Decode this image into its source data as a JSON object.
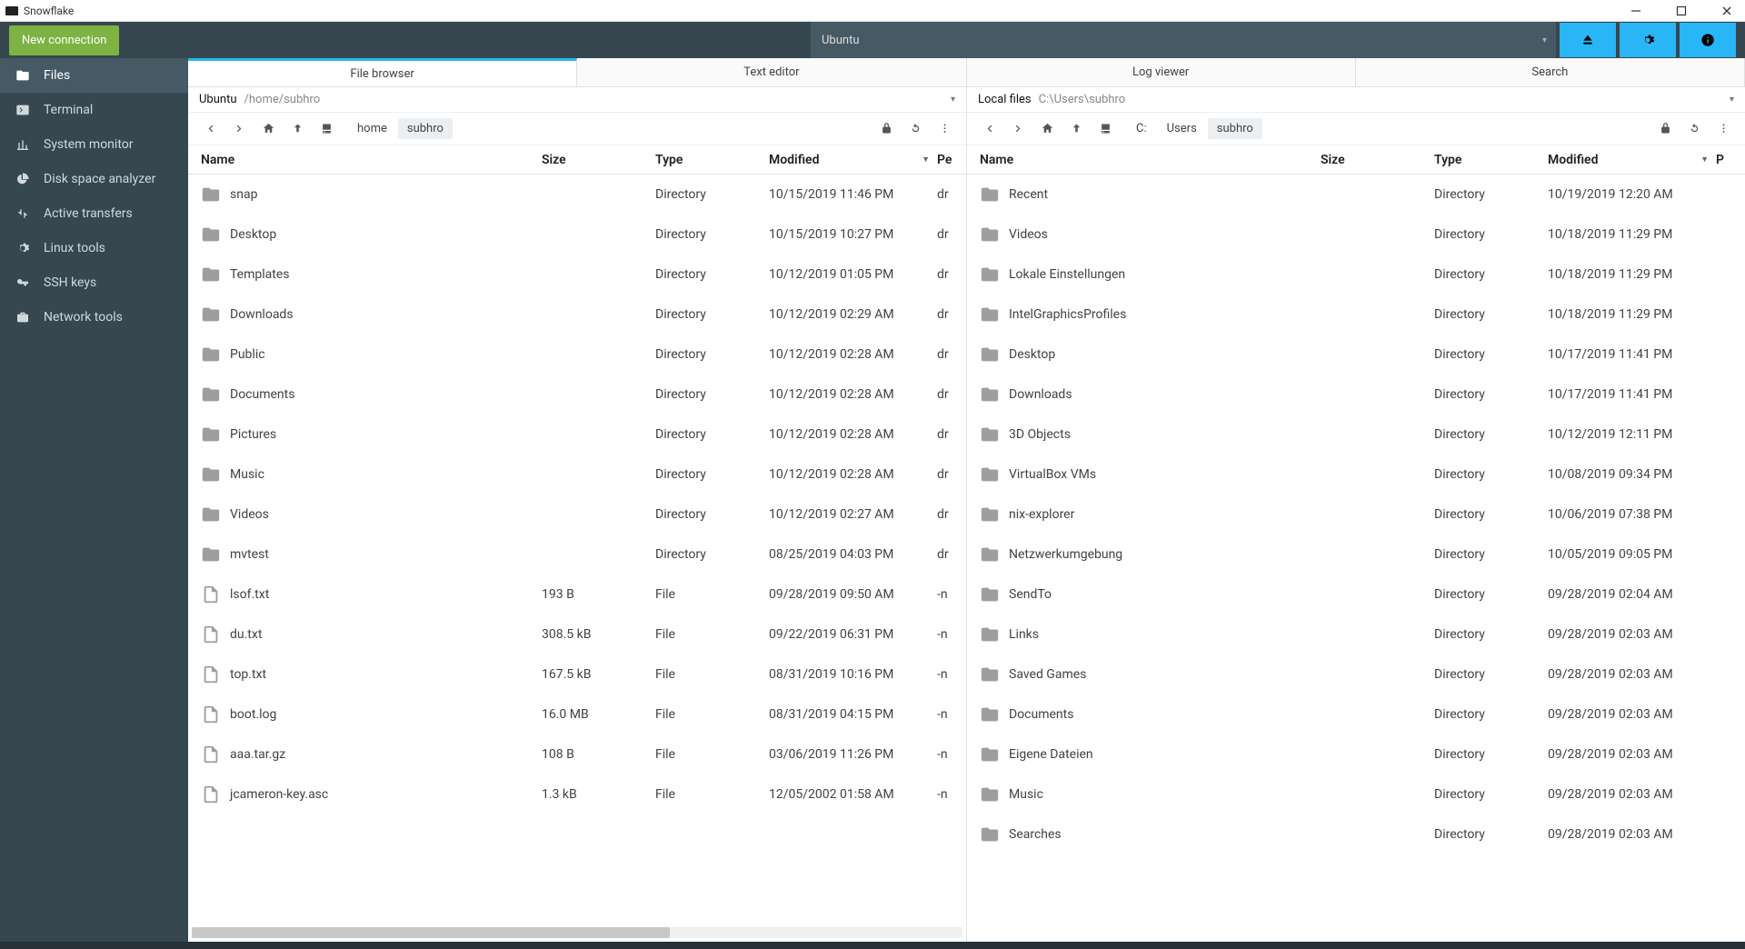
{
  "app_title": "Snowflake",
  "toolbar": {
    "new_connection": "New connection",
    "session_label": "Ubuntu"
  },
  "sidebar": {
    "items": [
      {
        "label": "Files",
        "icon": "folder"
      },
      {
        "label": "Terminal",
        "icon": "terminal"
      },
      {
        "label": "System monitor",
        "icon": "chart"
      },
      {
        "label": "Disk space analyzer",
        "icon": "pie"
      },
      {
        "label": "Active transfers",
        "icon": "transfer"
      },
      {
        "label": "Linux tools",
        "icon": "gear"
      },
      {
        "label": "SSH keys",
        "icon": "key"
      },
      {
        "label": "Network tools",
        "icon": "briefcase"
      }
    ],
    "active_index": 0
  },
  "tabs": {
    "items": [
      "File browser",
      "Text editor",
      "Log viewer",
      "Search"
    ],
    "active_index": 0
  },
  "left_pane": {
    "host": "Ubuntu",
    "path": "/home/subhro",
    "breadcrumbs": [
      "home",
      "subhro"
    ],
    "columns": {
      "name": "Name",
      "size": "Size",
      "type": "Type",
      "modified": "Modified",
      "perm": "Pe"
    },
    "sort_col": "modified",
    "sort_dir": "desc",
    "rows": [
      {
        "name": "snap",
        "size": "",
        "type": "Directory",
        "modified": "10/15/2019 11:46 PM",
        "perm": "dr",
        "kind": "folder"
      },
      {
        "name": "Desktop",
        "size": "",
        "type": "Directory",
        "modified": "10/15/2019 10:27 PM",
        "perm": "dr",
        "kind": "folder"
      },
      {
        "name": "Templates",
        "size": "",
        "type": "Directory",
        "modified": "10/12/2019 01:05 PM",
        "perm": "dr",
        "kind": "folder"
      },
      {
        "name": "Downloads",
        "size": "",
        "type": "Directory",
        "modified": "10/12/2019 02:29 AM",
        "perm": "dr",
        "kind": "folder"
      },
      {
        "name": "Public",
        "size": "",
        "type": "Directory",
        "modified": "10/12/2019 02:28 AM",
        "perm": "dr",
        "kind": "folder"
      },
      {
        "name": "Documents",
        "size": "",
        "type": "Directory",
        "modified": "10/12/2019 02:28 AM",
        "perm": "dr",
        "kind": "folder"
      },
      {
        "name": "Pictures",
        "size": "",
        "type": "Directory",
        "modified": "10/12/2019 02:28 AM",
        "perm": "dr",
        "kind": "folder"
      },
      {
        "name": "Music",
        "size": "",
        "type": "Directory",
        "modified": "10/12/2019 02:28 AM",
        "perm": "dr",
        "kind": "folder"
      },
      {
        "name": "Videos",
        "size": "",
        "type": "Directory",
        "modified": "10/12/2019 02:27 AM",
        "perm": "dr",
        "kind": "folder"
      },
      {
        "name": "mvtest",
        "size": "",
        "type": "Directory",
        "modified": "08/25/2019 04:03 PM",
        "perm": "dr",
        "kind": "folder"
      },
      {
        "name": "lsof.txt",
        "size": "193 B",
        "type": "File",
        "modified": "09/28/2019 09:50 AM",
        "perm": "-n",
        "kind": "file"
      },
      {
        "name": "du.txt",
        "size": "308.5 kB",
        "type": "File",
        "modified": "09/22/2019 06:31 PM",
        "perm": "-n",
        "kind": "file"
      },
      {
        "name": "top.txt",
        "size": "167.5 kB",
        "type": "File",
        "modified": "08/31/2019 10:16 PM",
        "perm": "-n",
        "kind": "file"
      },
      {
        "name": "boot.log",
        "size": "16.0 MB",
        "type": "File",
        "modified": "08/31/2019 04:15 PM",
        "perm": "-n",
        "kind": "file"
      },
      {
        "name": "aaa.tar.gz",
        "size": "108 B",
        "type": "File",
        "modified": "03/06/2019 11:26 PM",
        "perm": "-n",
        "kind": "file"
      },
      {
        "name": "jcameron-key.asc",
        "size": "1.3 kB",
        "type": "File",
        "modified": "12/05/2002 01:58 AM",
        "perm": "-n",
        "kind": "file"
      }
    ]
  },
  "right_pane": {
    "host": "Local files",
    "path": "C:\\Users\\subhro",
    "breadcrumbs": [
      "C:",
      "Users",
      "subhro"
    ],
    "columns": {
      "name": "Name",
      "size": "Size",
      "type": "Type",
      "modified": "Modified",
      "perm": "P"
    },
    "sort_col": "modified",
    "sort_dir": "desc",
    "rows": [
      {
        "name": "Recent",
        "size": "",
        "type": "Directory",
        "modified": "10/19/2019 12:20 AM",
        "kind": "folder"
      },
      {
        "name": "Videos",
        "size": "",
        "type": "Directory",
        "modified": "10/18/2019 11:29 PM",
        "kind": "folder"
      },
      {
        "name": "Lokale Einstellungen",
        "size": "",
        "type": "Directory",
        "modified": "10/18/2019 11:29 PM",
        "kind": "folder"
      },
      {
        "name": "IntelGraphicsProfiles",
        "size": "",
        "type": "Directory",
        "modified": "10/18/2019 11:29 PM",
        "kind": "folder"
      },
      {
        "name": "Desktop",
        "size": "",
        "type": "Directory",
        "modified": "10/17/2019 11:41 PM",
        "kind": "folder"
      },
      {
        "name": "Downloads",
        "size": "",
        "type": "Directory",
        "modified": "10/17/2019 11:41 PM",
        "kind": "folder"
      },
      {
        "name": "3D Objects",
        "size": "",
        "type": "Directory",
        "modified": "10/12/2019 12:11 PM",
        "kind": "folder"
      },
      {
        "name": "VirtualBox VMs",
        "size": "",
        "type": "Directory",
        "modified": "10/08/2019 09:34 PM",
        "kind": "folder"
      },
      {
        "name": "nix-explorer",
        "size": "",
        "type": "Directory",
        "modified": "10/06/2019 07:38 PM",
        "kind": "folder"
      },
      {
        "name": "Netzwerkumgebung",
        "size": "",
        "type": "Directory",
        "modified": "10/05/2019 09:05 PM",
        "kind": "folder"
      },
      {
        "name": "SendTo",
        "size": "",
        "type": "Directory",
        "modified": "09/28/2019 02:04 AM",
        "kind": "folder"
      },
      {
        "name": "Links",
        "size": "",
        "type": "Directory",
        "modified": "09/28/2019 02:03 AM",
        "kind": "folder"
      },
      {
        "name": "Saved Games",
        "size": "",
        "type": "Directory",
        "modified": "09/28/2019 02:03 AM",
        "kind": "folder"
      },
      {
        "name": "Documents",
        "size": "",
        "type": "Directory",
        "modified": "09/28/2019 02:03 AM",
        "kind": "folder"
      },
      {
        "name": "Eigene Dateien",
        "size": "",
        "type": "Directory",
        "modified": "09/28/2019 02:03 AM",
        "kind": "folder"
      },
      {
        "name": "Music",
        "size": "",
        "type": "Directory",
        "modified": "09/28/2019 02:03 AM",
        "kind": "folder"
      },
      {
        "name": "Searches",
        "size": "",
        "type": "Directory",
        "modified": "09/28/2019 02:03 AM",
        "kind": "folder"
      }
    ]
  }
}
